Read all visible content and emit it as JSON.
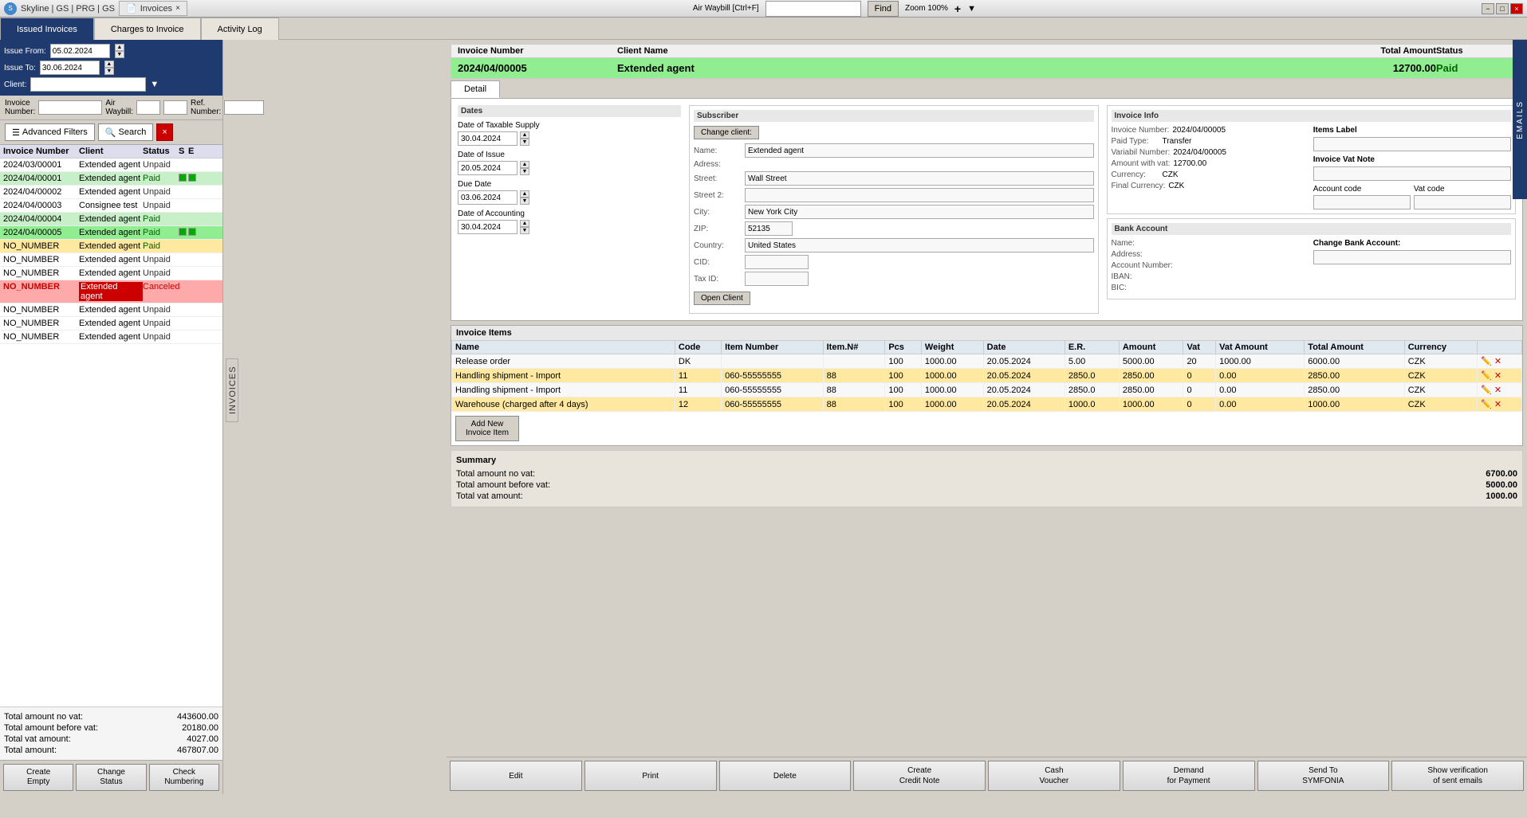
{
  "titlebar": {
    "app_name": "Skyline | GS | PRG | GS",
    "tab_label": "Invoices",
    "waybill_label": "Air Waybill [Ctrl+F]",
    "find_btn": "Find",
    "zoom_label": "Zoom 100%",
    "min_btn": "−",
    "max_btn": "□",
    "close_btn": "×"
  },
  "main_tabs": {
    "issued": "Issued Invoices",
    "charges": "Charges to Invoice",
    "activity": "Activity Log"
  },
  "filters": {
    "issue_from_label": "Issue From:",
    "issue_to_label": "Issue To:",
    "client_label": "Client:",
    "invoice_number_label": "Invoice Number:",
    "air_waybill_label": "Air Waybill:",
    "ref_number_label": "Ref. Number:",
    "issue_from_value": "05.02.2024",
    "issue_to_value": "30.06.2024",
    "adv_filter_btn": "Advanced Filters",
    "search_btn": "Search",
    "clear_btn": "×"
  },
  "invoice_list": {
    "col_invoice_number": "Invoice Number",
    "col_client": "Client",
    "col_status": "Status",
    "col_s": "S",
    "col_e": "E",
    "rows": [
      {
        "number": "2024/03/00001",
        "client": "Extended agent",
        "status": "Unpaid",
        "color": "unpaid",
        "s": "",
        "e": ""
      },
      {
        "number": "2024/04/00001",
        "client": "Extended agent",
        "status": "Paid",
        "color": "paid",
        "s": "green",
        "e": "green"
      },
      {
        "number": "2024/04/00002",
        "client": "Extended agent",
        "status": "Unpaid",
        "color": "unpaid",
        "s": "",
        "e": ""
      },
      {
        "number": "2024/04/00003",
        "client": "Consignee test",
        "status": "Unpaid",
        "color": "unpaid",
        "s": "",
        "e": ""
      },
      {
        "number": "2024/04/00004",
        "client": "Extended agent",
        "status": "Paid",
        "color": "paid",
        "s": "",
        "e": ""
      },
      {
        "number": "2024/04/00005",
        "client": "Extended agent",
        "status": "Paid",
        "color": "selected",
        "s": "green",
        "e": "green"
      },
      {
        "number": "NO_NUMBER",
        "client": "Extended agent",
        "status": "Paid",
        "color": "no-number",
        "s": "",
        "e": ""
      },
      {
        "number": "NO_NUMBER",
        "client": "Extended agent",
        "status": "Unpaid",
        "color": "unpaid",
        "s": "",
        "e": ""
      },
      {
        "number": "NO_NUMBER",
        "client": "Extended agent",
        "status": "Unpaid",
        "color": "unpaid",
        "s": "",
        "e": ""
      },
      {
        "number": "NO_NUMBER",
        "client": "Extended agent",
        "status": "Canceled",
        "color": "canceled",
        "s": "",
        "e": ""
      },
      {
        "number": "NO_NUMBER",
        "client": "Extended agent",
        "status": "Unpaid",
        "color": "unpaid",
        "s": "",
        "e": ""
      },
      {
        "number": "NO_NUMBER",
        "client": "Extended agent",
        "status": "Unpaid",
        "color": "unpaid",
        "s": "",
        "e": ""
      },
      {
        "number": "NO_NUMBER",
        "client": "Extended agent",
        "status": "Unpaid",
        "color": "unpaid",
        "s": "",
        "e": ""
      }
    ]
  },
  "totals": {
    "no_vat_label": "Total amount no vat:",
    "before_vat_label": "Total amount before vat:",
    "vat_label": "Total vat amount:",
    "total_label": "Total amount:",
    "no_vat_value": "443600.00",
    "before_vat_value": "20180.00",
    "vat_value": "4027.00",
    "total_value": "467807.00"
  },
  "left_actions": {
    "create_empty": "Create\nEmpty",
    "change_status": "Change\nStatus",
    "check_numbering": "Check\nNumbering"
  },
  "selected_invoice": {
    "number": "2024/04/00005",
    "client_name": "Extended agent",
    "total_amount": "12700.00",
    "status": "Paid",
    "col_number": "Invoice Number",
    "col_client": "Client Name",
    "col_total": "Total Amount",
    "col_status": "Status"
  },
  "detail_tab": "Detail",
  "dates_section": {
    "title": "Dates",
    "taxable_supply_label": "Date of Taxable Supply",
    "taxable_supply_value": "30.04.2024",
    "issue_label": "Date of Issue",
    "issue_value": "20.05.2024",
    "due_label": "Due Date",
    "due_value": "03.06.2024",
    "accounting_label": "Date of Accounting",
    "accounting_value": "30.04.2024"
  },
  "subscriber_section": {
    "title": "Subscriber",
    "change_client_btn": "Change client:",
    "name_label": "Name:",
    "name_value": "Extended agent",
    "address_label": "Adress:",
    "street_label": "Street:",
    "street_value": "Wall Street",
    "street2_label": "Street 2:",
    "street2_value": "",
    "city_label": "City:",
    "city_value": "New York City",
    "zip_label": "ZIP:",
    "zip_value": "52135",
    "country_label": "Country:",
    "country_value": "United States",
    "cid_label": "CID:",
    "cid_value": "",
    "tax_id_label": "Tax ID:",
    "tax_id_value": "",
    "open_client_btn": "Open Client"
  },
  "invoice_info": {
    "title": "Invoice Info",
    "number_label": "Invoice Number:",
    "number_value": "2024/04/00005",
    "paid_type_label": "Paid Type:",
    "paid_type_value": "Transfer",
    "variabil_label": "Variabil Number:",
    "variabil_value": "2024/04/00005",
    "amount_vat_label": "Amount with vat:",
    "amount_vat_value": "12700.00",
    "currency_label": "Currency:",
    "currency_value": "CZK",
    "final_currency_label": "Final Currency:",
    "final_currency_value": "CZK",
    "items_label_title": "Items Label",
    "items_label_value": "",
    "vat_note_title": "Invoice Vat Note",
    "vat_note_value": "",
    "account_code_label": "Account code",
    "account_code_value": "",
    "vat_code_label": "Vat code",
    "vat_code_value": ""
  },
  "bank_account": {
    "title": "Bank Account",
    "name_label": "Name:",
    "name_value": "",
    "address_label": "Address:",
    "address_value": "",
    "account_number_label": "Account Number:",
    "account_number_value": "",
    "iban_label": "IBAN:",
    "iban_value": "",
    "bic_label": "BIC:",
    "bic_value": "",
    "change_bank_label": "Change Bank Account:",
    "change_bank_value": ""
  },
  "invoice_items": {
    "title": "Invoice Items",
    "cols": [
      "Name",
      "Code",
      "Item Number",
      "Item.N#",
      "Pcs",
      "Weight",
      "Date",
      "E.R.",
      "Amount",
      "Vat",
      "Vat Amount",
      "Total Amount",
      "Currency"
    ],
    "rows": [
      {
        "name": "Release order",
        "code": "DK",
        "item_number": "",
        "item_no": "",
        "pcs": "100",
        "weight": "1000.00",
        "date": "20.05.2024",
        "er": "5.00",
        "amount": "5000.00",
        "vat": "20",
        "vat_amount": "1000.00",
        "total": "6000.00",
        "currency": "CZK"
      },
      {
        "name": "Handling shipment - Import",
        "code": "11",
        "item_number": "060-55555555",
        "item_no": "88",
        "pcs": "100",
        "weight": "1000.00",
        "date": "20.05.2024",
        "er": "2850.0",
        "amount": "2850.00",
        "vat": "0",
        "vat_amount": "0.00",
        "total": "2850.00",
        "currency": "CZK"
      },
      {
        "name": "Handling shipment - Import",
        "code": "11",
        "item_number": "060-55555555",
        "item_no": "88",
        "pcs": "100",
        "weight": "1000.00",
        "date": "20.05.2024",
        "er": "2850.0",
        "amount": "2850.00",
        "vat": "0",
        "vat_amount": "0.00",
        "total": "2850.00",
        "currency": "CZK"
      },
      {
        "name": "Warehouse (charged after 4 days)",
        "code": "12",
        "item_number": "060-55555555",
        "item_no": "88",
        "pcs": "100",
        "weight": "1000.00",
        "date": "20.05.2024",
        "er": "1000.0",
        "amount": "1000.00",
        "vat": "0",
        "vat_amount": "0.00",
        "total": "1000.00",
        "currency": "CZK"
      }
    ],
    "add_btn": "Add New\nInvoice Item"
  },
  "summary": {
    "title": "Summary",
    "no_vat_label": "Total amount no vat:",
    "no_vat_value": "6700.00",
    "before_vat_label": "Total amount before vat:",
    "before_vat_value": "5000.00",
    "total_vat_label": "Total vat amount:",
    "total_vat_value": "1000.00"
  },
  "invoice_actions": {
    "edit": "Edit",
    "print": "Print",
    "delete": "Delete",
    "create_credit_note": "Create\nCredit Note",
    "cash_voucher": "Cash\nVoucher",
    "demand_for_payment": "Demand\nfor Payment",
    "send_to_symfonia": "Send To\nSYMFONIA",
    "show_verification": "Show verification\nof sent emails"
  },
  "sidebar_labels": {
    "invoices": "INVOICES",
    "emails": "EMAILS"
  }
}
